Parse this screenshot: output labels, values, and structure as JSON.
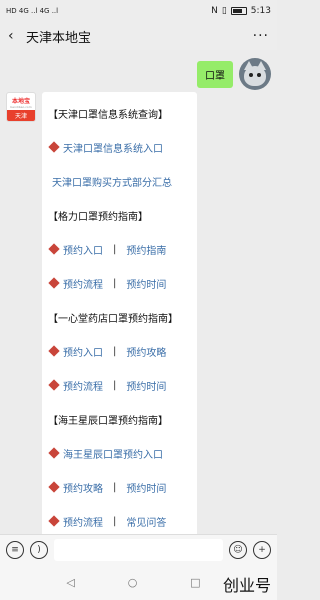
{
  "status": {
    "left_icons": "HD 4G ..l 4G ..l",
    "time": "5:13"
  },
  "header": {
    "title": "天津本地宝",
    "more": "···"
  },
  "sent_message": {
    "text": "口罩"
  },
  "reply_avatar": {
    "top": "本地宝",
    "mid": "bendibao.com",
    "bottom": "天津"
  },
  "reply": {
    "l0": "【天津口罩信息系统查询】",
    "l1": "天津口罩信息系统入口",
    "l2": "天津口罩购买方式部分汇总",
    "l3": "【格力口罩预约指南】",
    "l4a": "预约入口",
    "l4b": "预约指南",
    "l5a": "预约流程",
    "l5b": "预约时间",
    "l6": "【一心堂药店口罩预约指南】",
    "l7a": "预约入口",
    "l7b": "预约攻略",
    "l8a": "预约流程",
    "l8b": "预约时间",
    "l9": "【海王星辰口罩预约指南】",
    "l10": "海王星辰口罩预约入口",
    "l11a": "预约攻略",
    "l11b": "预约时间",
    "l12a": "预约流程",
    "l12b": "常见问答",
    "sep": "|"
  },
  "input": {
    "voice_icon": "voice-icon",
    "emoji_icon": "emoji-icon",
    "plus_icon": "plus-icon"
  },
  "watermark": "创业号"
}
